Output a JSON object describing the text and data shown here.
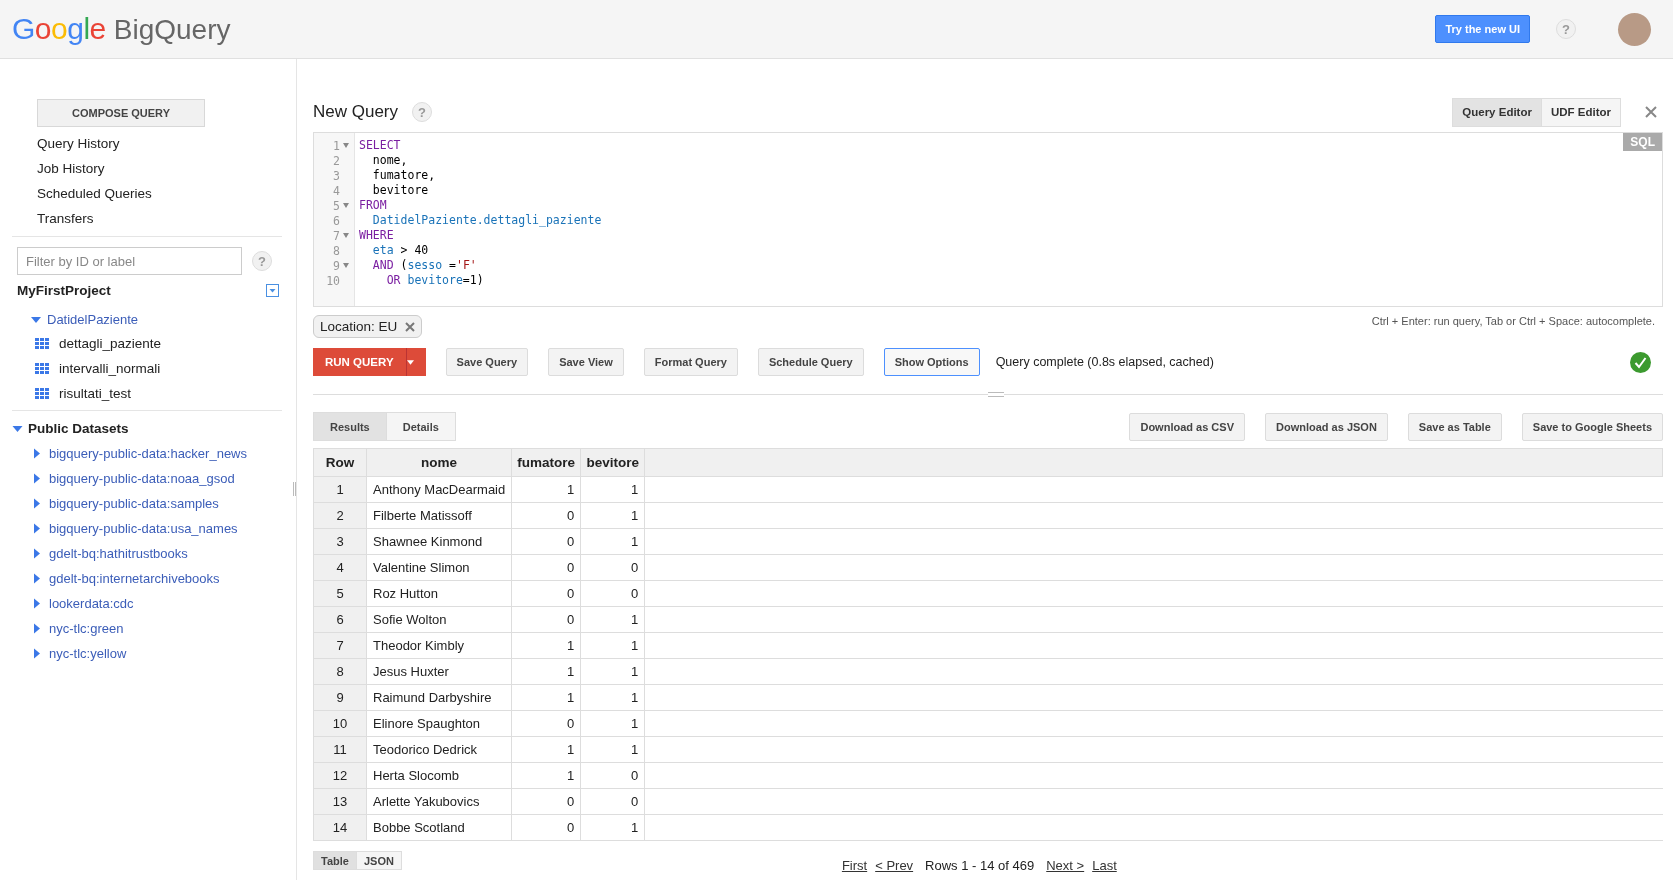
{
  "header": {
    "logo_letters": [
      {
        "text": "G",
        "color": "#4285f4"
      },
      {
        "text": "o",
        "color": "#ea4335"
      },
      {
        "text": "o",
        "color": "#fbbc05"
      },
      {
        "text": "g",
        "color": "#4285f4"
      },
      {
        "text": "l",
        "color": "#34a853"
      },
      {
        "text": "e",
        "color": "#ea4335"
      }
    ],
    "product": "BigQuery",
    "try_button": "Try the new UI",
    "help": "?"
  },
  "sidebar": {
    "compose_button": "COMPOSE QUERY",
    "nav": [
      "Query History",
      "Job History",
      "Scheduled Queries",
      "Transfers"
    ],
    "filter": {
      "placeholder": "Filter by ID or label",
      "help": "?"
    },
    "project": {
      "name": "MyFirstProject",
      "datasets": [
        {
          "name": "DatidelPaziente",
          "expanded": true,
          "children": [
            {
              "name": "dettagli_paziente"
            },
            {
              "name": "intervalli_normali"
            },
            {
              "name": "risultati_test"
            }
          ]
        }
      ]
    },
    "public_datasets": {
      "title": "Public Datasets",
      "expanded": true,
      "children": [
        {
          "name": "bigquery-public-data:hacker_news",
          "expanded": false
        },
        {
          "name": "bigquery-public-data:noaa_gsod",
          "expanded": false
        },
        {
          "name": "bigquery-public-data:samples",
          "expanded": false
        },
        {
          "name": "bigquery-public-data:usa_names",
          "expanded": false
        },
        {
          "name": "gdelt-bq:hathitrustbooks",
          "expanded": false
        },
        {
          "name": "gdelt-bq:internetarchivebooks",
          "expanded": false
        },
        {
          "name": "lookerdata:cdc",
          "expanded": false
        },
        {
          "name": "nyc-tlc:green",
          "expanded": false
        },
        {
          "name": "nyc-tlc:yellow",
          "expanded": false
        }
      ]
    }
  },
  "query": {
    "title": "New Query",
    "help": "?",
    "editor_tabs": [
      {
        "label": "Query Editor",
        "selected": true
      },
      {
        "label": "UDF Editor",
        "selected": false
      }
    ],
    "language_badge": "SQL",
    "lines": [
      {
        "number": "1",
        "fold": true,
        "tokens": [
          {
            "kind": "keyword",
            "text": "SELECT"
          }
        ]
      },
      {
        "number": "2",
        "fold": false,
        "tokens": [
          {
            "kind": "plain",
            "text": "  nome,"
          }
        ]
      },
      {
        "number": "3",
        "fold": false,
        "tokens": [
          {
            "kind": "plain",
            "text": "  fumatore,"
          }
        ]
      },
      {
        "number": "4",
        "fold": false,
        "tokens": [
          {
            "kind": "plain",
            "text": "  bevitore"
          }
        ]
      },
      {
        "number": "5",
        "fold": true,
        "tokens": [
          {
            "kind": "keyword",
            "text": "FROM"
          }
        ]
      },
      {
        "number": "6",
        "fold": false,
        "tokens": [
          {
            "kind": "identifier",
            "text": "  DatidelPaziente.dettagli_paziente"
          }
        ]
      },
      {
        "number": "7",
        "fold": true,
        "tokens": [
          {
            "kind": "keyword",
            "text": "WHERE"
          }
        ]
      },
      {
        "number": "8",
        "fold": false,
        "tokens": [
          {
            "kind": "identifier",
            "text": "  eta"
          },
          {
            "kind": "plain",
            "text": " > 40"
          }
        ]
      },
      {
        "number": "9",
        "fold": true,
        "tokens": [
          {
            "kind": "keyword",
            "text": "  AND"
          },
          {
            "kind": "plain",
            "text": " ("
          },
          {
            "kind": "identifier",
            "text": "sesso"
          },
          {
            "kind": "plain",
            "text": " ="
          },
          {
            "kind": "string",
            "text": "'F'"
          }
        ]
      },
      {
        "number": "10",
        "fold": false,
        "tokens": [
          {
            "kind": "keyword",
            "text": "    OR"
          },
          {
            "kind": "identifier",
            "text": " bevitore"
          },
          {
            "kind": "plain",
            "text": "=1)"
          }
        ]
      }
    ],
    "location_chip": "Location: EU",
    "hint": "Ctrl + Enter: run query, Tab or Ctrl + Space: autocomplete.",
    "run_button": "RUN QUERY",
    "buttons": [
      {
        "label": "Save Query",
        "focused": false
      },
      {
        "label": "Save View",
        "focused": false
      },
      {
        "label": "Format Query",
        "focused": false
      },
      {
        "label": "Schedule Query",
        "focused": false
      },
      {
        "label": "Show Options",
        "focused": true
      }
    ],
    "status": "Query complete (0.8s elapsed, cached)"
  },
  "results": {
    "tabs": [
      {
        "label": "Results",
        "selected": true
      },
      {
        "label": "Details",
        "selected": false
      }
    ],
    "actions": [
      "Download as CSV",
      "Download as JSON",
      "Save as Table",
      "Save to Google Sheets"
    ],
    "columns": [
      "Row",
      "nome",
      "fumatore",
      "bevitore"
    ],
    "rows": [
      [
        "1",
        "Anthony MacDearmaid",
        "1",
        "1"
      ],
      [
        "2",
        "Filberte Matissoff",
        "0",
        "1"
      ],
      [
        "3",
        "Shawnee Kinmond",
        "0",
        "1"
      ],
      [
        "4",
        "Valentine Slimon",
        "0",
        "0"
      ],
      [
        "5",
        "Roz Hutton",
        "0",
        "0"
      ],
      [
        "6",
        "Sofie Wolton",
        "0",
        "1"
      ],
      [
        "7",
        "Theodor Kimbly",
        "1",
        "1"
      ],
      [
        "8",
        "Jesus Huxter",
        "1",
        "1"
      ],
      [
        "9",
        "Raimund Darbyshire",
        "1",
        "1"
      ],
      [
        "10",
        "Elinore Spaughton",
        "0",
        "1"
      ],
      [
        "11",
        "Teodorico Dedrick",
        "1",
        "1"
      ],
      [
        "12",
        "Herta Slocomb",
        "1",
        "0"
      ],
      [
        "13",
        "Arlette Yakubovics",
        "0",
        "0"
      ],
      [
        "14",
        "Bobbe Scotland",
        "0",
        "1"
      ]
    ],
    "view_tabs": [
      {
        "label": "Table",
        "selected": true
      },
      {
        "label": "JSON",
        "selected": false
      }
    ],
    "pagination": {
      "first": "First",
      "prev": "< Prev",
      "range": "Rows 1 - 14 of 469",
      "next": "Next >",
      "last": "Last"
    }
  }
}
